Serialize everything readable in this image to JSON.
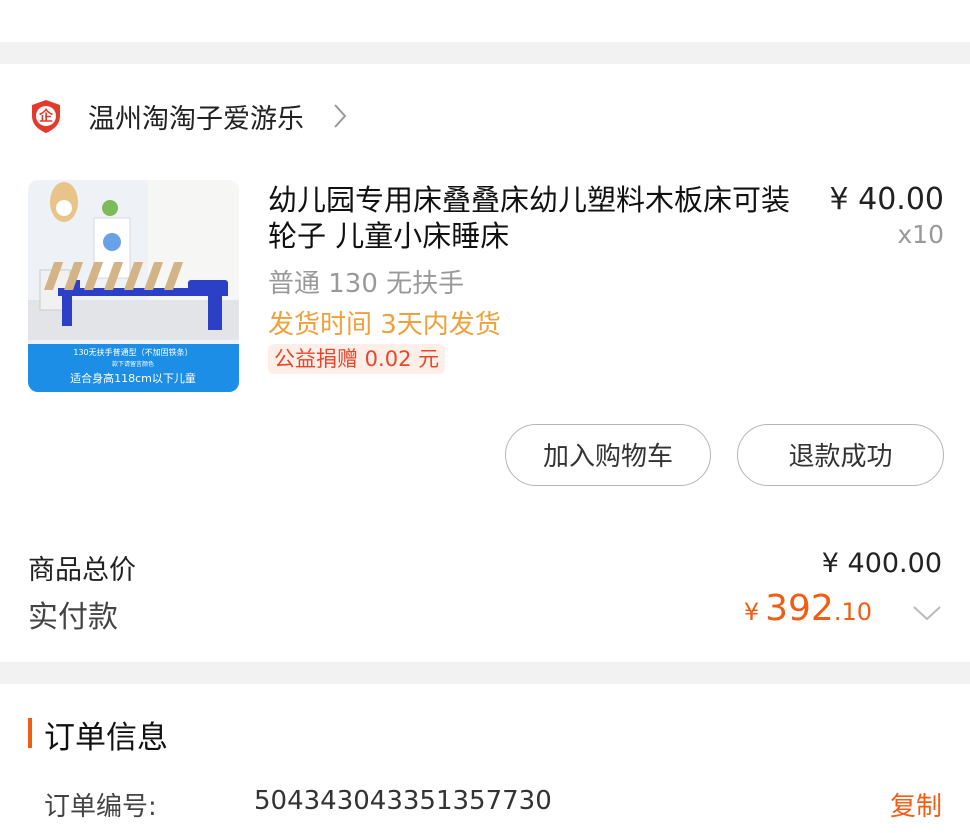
{
  "shop": {
    "name": "温州淘淘子爱游乐",
    "badge_text": "企"
  },
  "product": {
    "title": "幼儿园专用床叠叠床幼儿塑料木板床可装轮子 儿童小床睡床",
    "price": "¥ 40.00",
    "quantity": "x10",
    "sku": "普通 130 无扶手",
    "shipping": "发货时间 3天内发货",
    "charity": "公益捐赠 0.02 元",
    "image_caption_1": "130无扶手普通型（不加固铁条）",
    "image_caption_2": "款下请留言颜色",
    "image_caption_3": "适合身高118cm以下儿童"
  },
  "actions": {
    "add_to_cart": "加入购物车",
    "refund_status": "退款成功"
  },
  "summary": {
    "total_label": "商品总价",
    "total_value": "¥ 400.00",
    "paid_label": "实付款",
    "paid_currency": "¥",
    "paid_integer": "392",
    "paid_decimal": ".10"
  },
  "order_info": {
    "title": "订单信息",
    "order_no_label": "订单编号:",
    "order_no": "504343043351357730",
    "copy_label": "复制"
  },
  "colors": {
    "accent": "#f25d14",
    "shipping": "#f0a03a",
    "charity": "#e5472b",
    "muted": "#999999"
  }
}
